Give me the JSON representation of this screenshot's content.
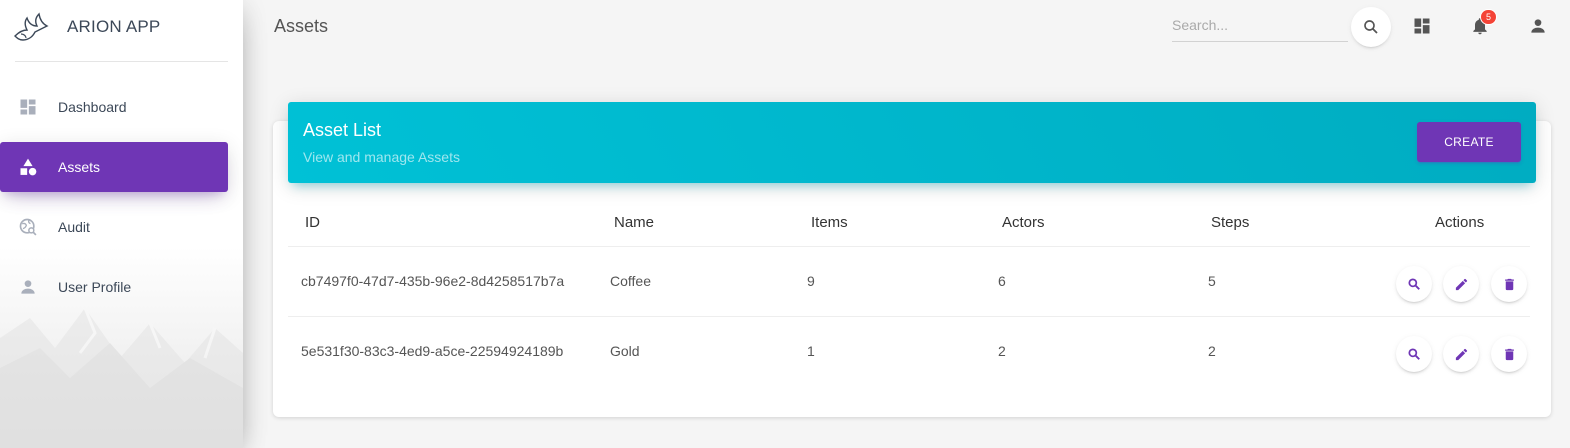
{
  "app": {
    "name": "ARION APP"
  },
  "sidebar": {
    "items": [
      {
        "label": "Dashboard",
        "icon": "dashboard-icon",
        "active": false
      },
      {
        "label": "Assets",
        "icon": "category-icon",
        "active": true
      },
      {
        "label": "Audit",
        "icon": "travel-explore-icon",
        "active": false
      },
      {
        "label": "User Profile",
        "icon": "person-icon",
        "active": false
      }
    ]
  },
  "header": {
    "title": "Assets",
    "search_placeholder": "Search...",
    "notification_count": "5"
  },
  "card": {
    "title": "Asset List",
    "subtitle": "View and manage Assets",
    "create_label": "CREATE"
  },
  "table": {
    "columns": [
      "ID",
      "Name",
      "Items",
      "Actors",
      "Steps",
      "Actions"
    ],
    "rows": [
      {
        "id": "cb7497f0-47d7-435b-96e2-8d4258517b7a",
        "name": "Coffee",
        "items": "9",
        "actors": "6",
        "steps": "5"
      },
      {
        "id": "5e531f30-83c3-4ed9-a5ce-22594924189b",
        "name": "Gold",
        "items": "1",
        "actors": "2",
        "steps": "2"
      }
    ]
  },
  "colors": {
    "primary": "#6f36b5",
    "header_cyan": "#00bcd4",
    "badge": "#f44336"
  }
}
